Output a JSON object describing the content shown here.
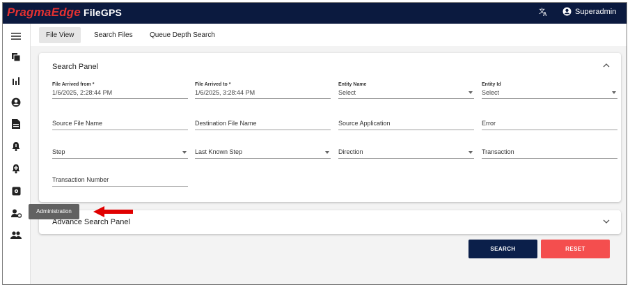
{
  "header": {
    "brand_primary": "PragmaEdge",
    "brand_secondary": "FileGPS",
    "translate_icon": "translate-icon",
    "user_name": "Superadmin",
    "user_icon": "account-circle-icon"
  },
  "sidebar": {
    "items": [
      {
        "icon": "menu-icon"
      },
      {
        "icon": "file-copy-icon"
      },
      {
        "icon": "bar-chart-icon"
      },
      {
        "icon": "account-circle-icon"
      },
      {
        "icon": "description-icon"
      },
      {
        "icon": "notification-bell-icon"
      },
      {
        "icon": "notification-bell-alert-icon"
      },
      {
        "icon": "settings-box-icon"
      },
      {
        "icon": "admin-user-gear-icon"
      },
      {
        "icon": "group-icon"
      }
    ],
    "tooltip": "Administration"
  },
  "tabs": [
    {
      "label": "File View",
      "active": true
    },
    {
      "label": "Search Files",
      "active": false
    },
    {
      "label": "Queue Depth Search",
      "active": false
    }
  ],
  "search_panel": {
    "title": "Search Panel",
    "file_arrived_from": {
      "label": "File Arrived from *",
      "value": "1/6/2025, 2:28:44 PM"
    },
    "file_arrived_to": {
      "label": "File Arrived to *",
      "value": "1/6/2025, 3:28:44 PM"
    },
    "entity_name": {
      "label": "Entity Name",
      "value": "Select"
    },
    "entity_id": {
      "label": "Entity Id",
      "value": "Select"
    },
    "source_file_name": "Source File Name",
    "destination_file_name": "Destination File Name",
    "source_application": "Source Application",
    "error": "Error",
    "step": "Step",
    "last_known_step": "Last Known Step",
    "direction": "Direction",
    "transaction": "Transaction",
    "transaction_number": "Transaction Number"
  },
  "advance_panel": {
    "title": "Advance Search Panel"
  },
  "buttons": {
    "search": "SEARCH",
    "reset": "RESET"
  },
  "colors": {
    "topbar": "#0b1a3f",
    "brand_red": "#e43131",
    "search_button": "#0b1f4a",
    "reset_button": "#f44e4e",
    "annotation_arrow": "#e00000"
  }
}
